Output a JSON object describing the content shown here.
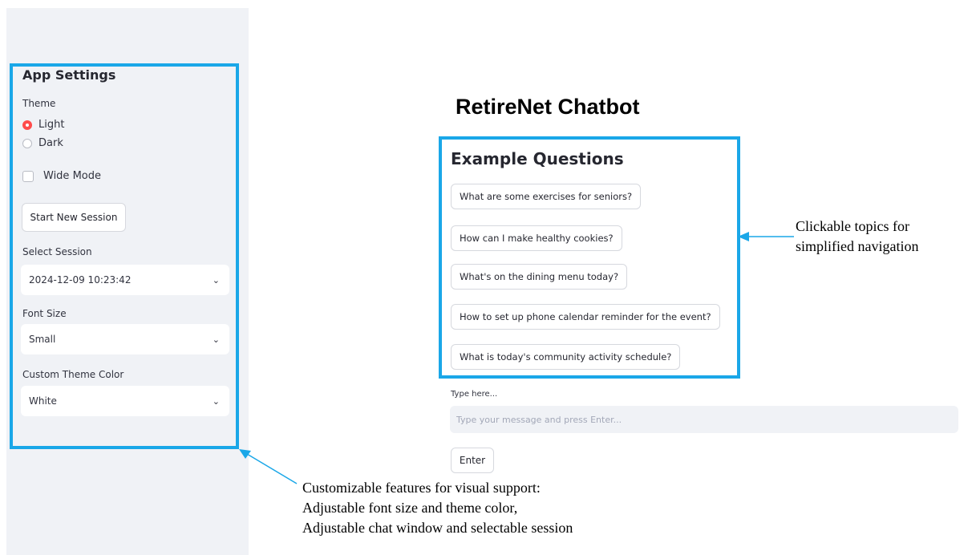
{
  "app": {
    "title": "RetireNet Chatbot"
  },
  "sidebar": {
    "title": "App Settings",
    "theme": {
      "label": "Theme",
      "options": [
        "Light",
        "Dark"
      ],
      "selected": "Light"
    },
    "wide_mode": {
      "label": "Wide Mode",
      "checked": false
    },
    "start_button": "Start New Session",
    "session": {
      "label": "Select Session",
      "value": "2024-12-09 10:23:42"
    },
    "font_size": {
      "label": "Font Size",
      "value": "Small"
    },
    "theme_color": {
      "label": "Custom Theme Color",
      "value": "White"
    }
  },
  "main": {
    "questions_title": "Example Questions",
    "questions": [
      "What are some exercises for seniors?",
      "How can I make healthy cookies?",
      "What's on the dining menu today?",
      "How to set up phone calendar reminder for the event?",
      "What is today's community activity schedule?"
    ],
    "input": {
      "label": "Type here...",
      "placeholder": "Type your message and press Enter...",
      "value": ""
    },
    "enter_button": "Enter"
  },
  "annotations": {
    "topics": [
      "Clickable topics for",
      "simplified navigation"
    ],
    "features": [
      "Customizable features for visual support:",
      "Adjustable font size and theme color,",
      "Adjustable chat window and selectable session"
    ]
  },
  "colors": {
    "accent": "#ff4b4b",
    "highlight": "#1aa7e8",
    "sidebar_bg": "#f0f2f6"
  }
}
